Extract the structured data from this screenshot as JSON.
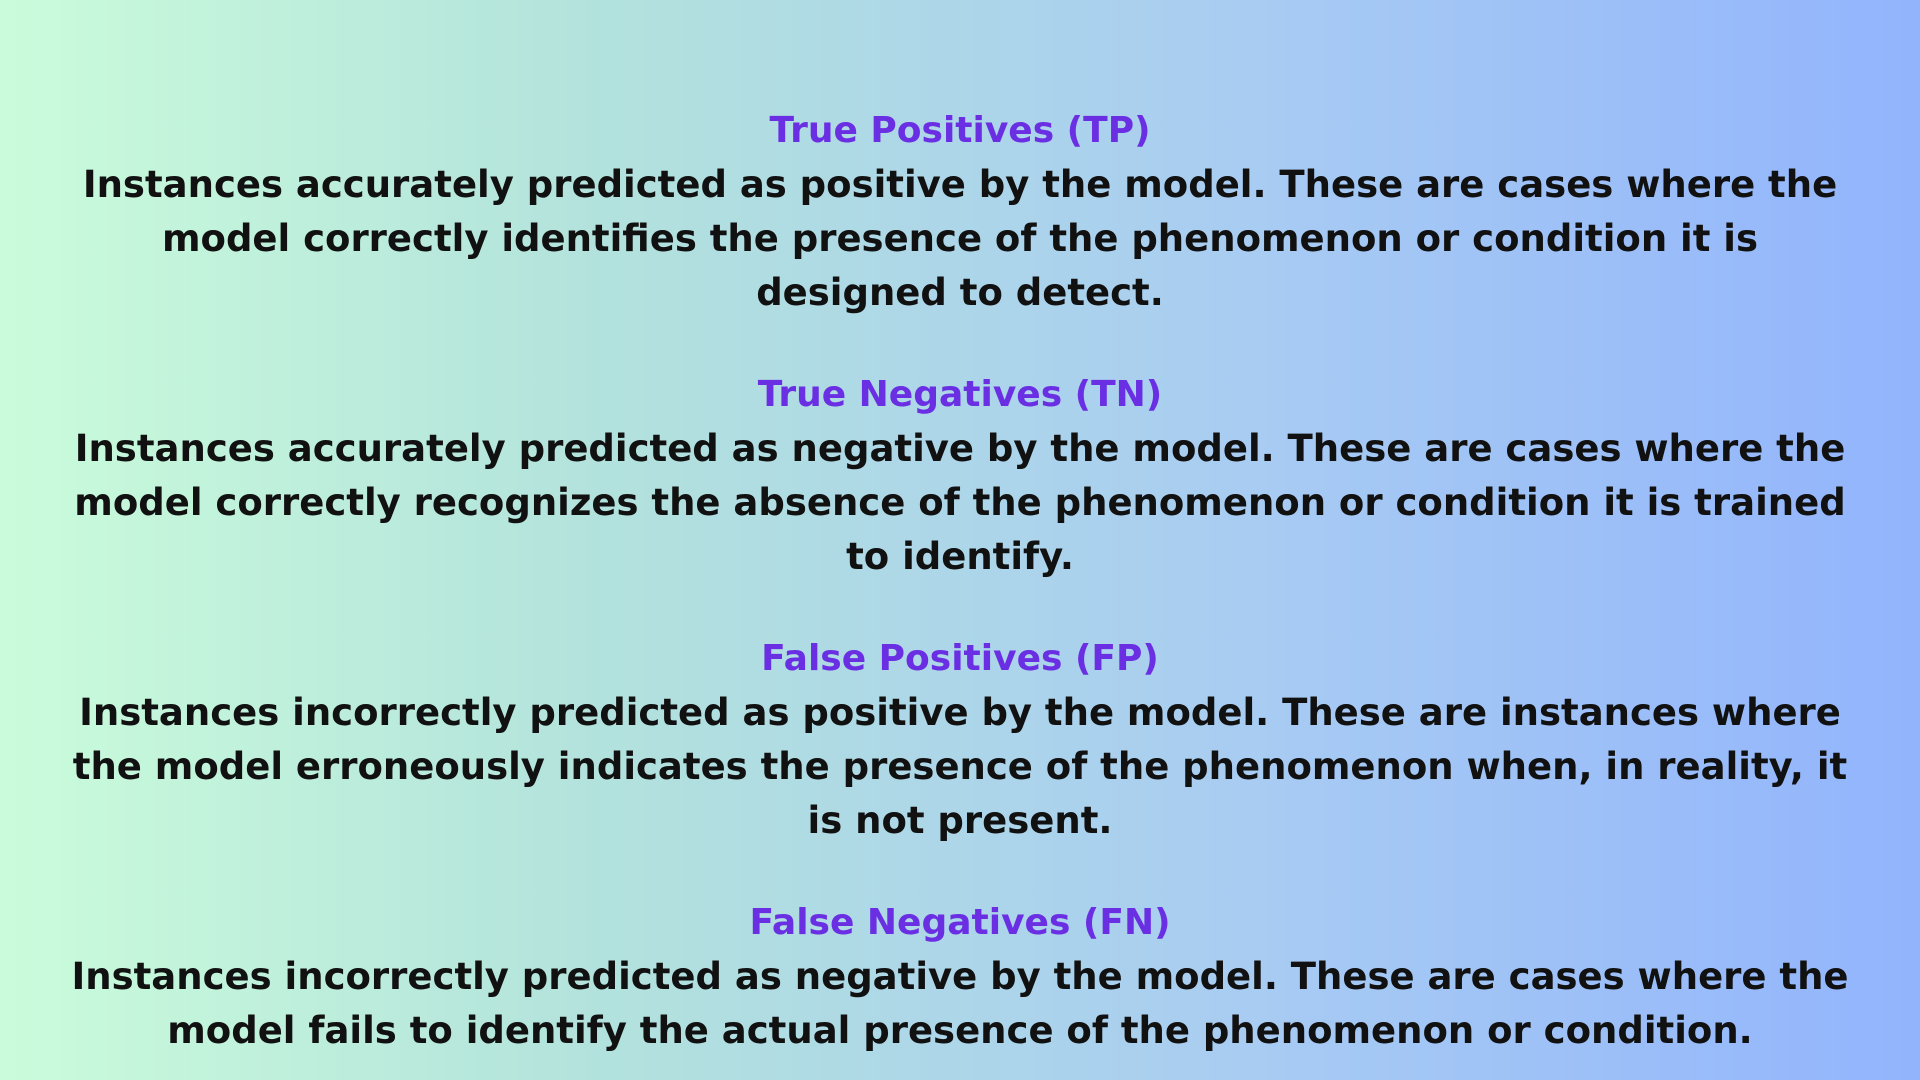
{
  "sections": [
    {
      "term": "True Positives (TP)",
      "definition": "Instances accurately predicted as positive by the model. These are cases where the model correctly identifies the presence of the phenomenon or condition it is designed to detect."
    },
    {
      "term": "True Negatives (TN)",
      "definition": "Instances accurately predicted as negative by the model. These are cases where the model correctly recognizes the absence of the phenomenon or condition it is trained to identify."
    },
    {
      "term": "False Positives (FP)",
      "definition": "Instances incorrectly predicted as positive by the model. These are instances where the model erroneously indicates the presence of the phenomenon when, in reality, it is not present."
    },
    {
      "term": "False Negatives (FN)",
      "definition": "Instances incorrectly predicted as negative by the model. These are cases where the model fails to identify the actual presence of the phenomenon or condition."
    }
  ],
  "colors": {
    "term": "#6b2fe3",
    "definition": "#111111",
    "gradient_left": "#cafcdb",
    "gradient_right": "#92b4fd"
  }
}
